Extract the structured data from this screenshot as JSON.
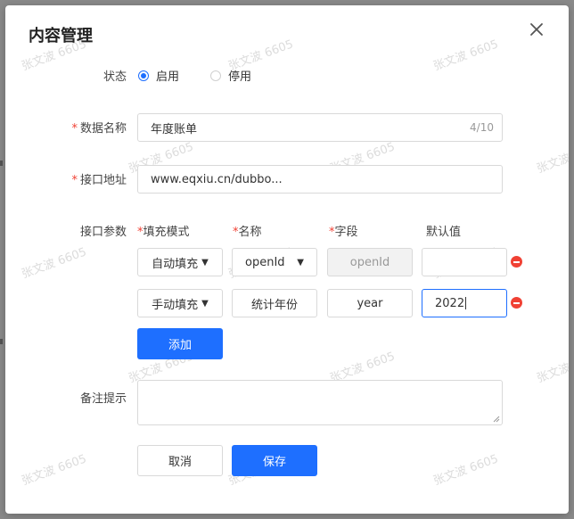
{
  "dialog": {
    "title": "内容管理",
    "watermark": "张文波 6605"
  },
  "status": {
    "label": "状态",
    "options": [
      {
        "label": "启用",
        "selected": true
      },
      {
        "label": "停用",
        "selected": false
      }
    ]
  },
  "data_name": {
    "label": "数据名称",
    "value": "年度账单",
    "counter": "4/10"
  },
  "api_address": {
    "label": "接口地址",
    "value": "www.eqxiu.cn/dubbo..."
  },
  "api_params": {
    "label": "接口参数",
    "headers": {
      "fill_mode": "填充模式",
      "name": "名称",
      "field": "字段",
      "default": "默认值"
    },
    "rows": [
      {
        "fill_mode": "自动填充",
        "name": "openId",
        "field": "openId",
        "default": ""
      },
      {
        "fill_mode": "手动填充",
        "name": "统计年份",
        "field": "year",
        "default": "2022"
      }
    ],
    "add_label": "添加"
  },
  "remark": {
    "label": "备注提示",
    "value": ""
  },
  "footer": {
    "cancel_label": "取消",
    "save_label": "保存"
  },
  "colors": {
    "primary": "#1e6fff",
    "danger": "#f04134"
  }
}
